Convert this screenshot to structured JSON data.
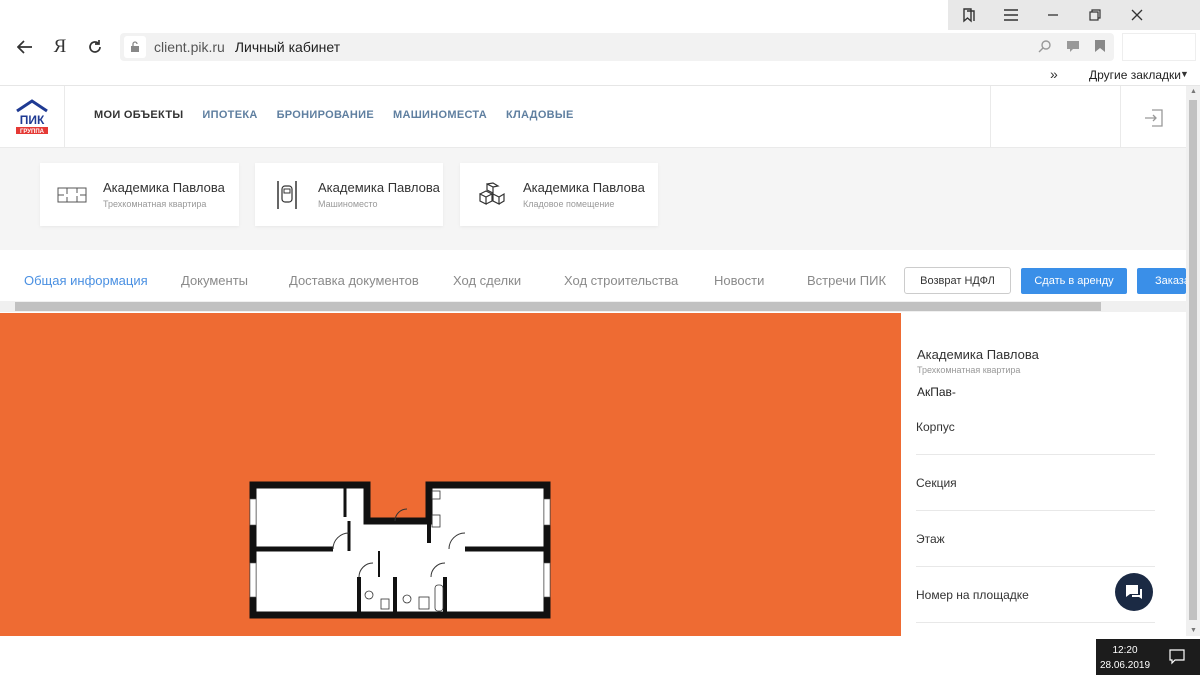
{
  "browser": {
    "url_domain": "client.pik.ru",
    "page_title": "Личный кабинет",
    "yandex_letter": "Я",
    "other_bookmarks": "Другие закладки",
    "chevrons": "»"
  },
  "header": {
    "logo_text": "ПИК",
    "logo_sub": "ГРУППА",
    "nav": [
      "МОИ ОБЪЕКТЫ",
      "ИПОТЕКА",
      "БРОНИРОВАНИЕ",
      "МАШИНОМЕСТА",
      "КЛАДОВЫЕ"
    ],
    "active_nav": 0
  },
  "objects": [
    {
      "title": "Академика Павлова",
      "subtitle": "Трехкомнатная квартира",
      "icon": "apartment-plan-icon"
    },
    {
      "title": "Академика Павлова",
      "subtitle": "Машиноместо",
      "icon": "parking-icon"
    },
    {
      "title": "Академика Павлова",
      "subtitle": "Кладовое помещение",
      "icon": "boxes-icon"
    }
  ],
  "tabs": [
    "Общая информация",
    "Документы",
    "Доставка документов",
    "Ход сделки",
    "Ход строительства",
    "Новости",
    "Встречи ПИК"
  ],
  "actions": {
    "ndfl": "Возврат НДФЛ",
    "rent": "Сдать в аренду",
    "order": "Заказа"
  },
  "details": {
    "title": "Академика Павлова",
    "subtitle": "Трехкомнатная квартира",
    "code": "АкПав-",
    "rows": [
      "Корпус",
      "Секция",
      "Этаж",
      "Номер на площадке"
    ]
  },
  "taskbar": {
    "time": "12:20",
    "date": "28.06.2019"
  },
  "colors": {
    "plan_background": "#ee6b33",
    "accent_blue": "#3a8fe8",
    "active_tab": "#4a90e2",
    "logo_blue": "#1f3a93",
    "logo_red": "#e53935"
  }
}
